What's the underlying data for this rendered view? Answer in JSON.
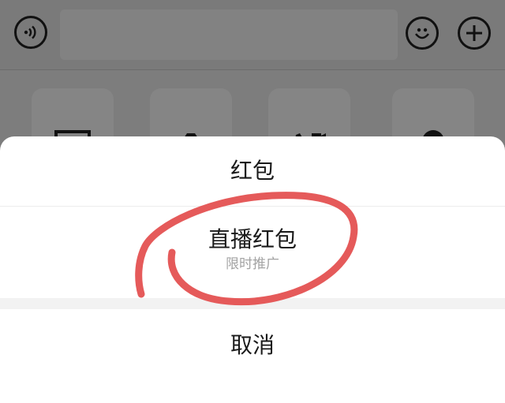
{
  "input_bar": {
    "voice_icon": "voice-wave-icon",
    "emoji_icon": "emoji-icon",
    "plus_icon": "plus-icon"
  },
  "tools": [
    {
      "icon": "photo-icon"
    },
    {
      "icon": "camera-icon"
    },
    {
      "icon": "video-call-icon"
    },
    {
      "icon": "location-icon"
    }
  ],
  "action_sheet": {
    "hongbao_label": "红包",
    "live_hongbao_label": "直播红包",
    "live_hongbao_subtitle": "限时推广",
    "cancel_label": "取消"
  },
  "colors": {
    "annotation": "#e55a5a",
    "overlay": "#7d7d7d",
    "sheet": "#ffffff",
    "subtitle": "#a3a3a3"
  }
}
